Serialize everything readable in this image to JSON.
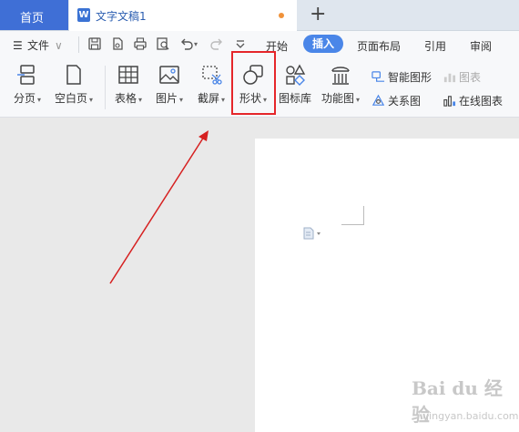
{
  "tabs": {
    "home_label": "首页",
    "doc_title": "文字文稿1",
    "doc_icon_letter": "W",
    "add_symbol": "+"
  },
  "menu": {
    "file_label": "文件",
    "items": [
      "开始",
      "插入",
      "页面布局",
      "引用",
      "审阅"
    ],
    "active": "插入"
  },
  "ribbon": {
    "page_break": "分页",
    "blank_page": "空白页",
    "table": "表格",
    "picture": "图片",
    "screenshot": "截屏",
    "shape": "形状",
    "icon_library": "图标库",
    "function_chart": "功能图",
    "smart_graphic": "智能图形",
    "chart": "图表",
    "relation_chart": "关系图",
    "online_chart": "在线图表",
    "dropdown": "▾"
  },
  "watermark": {
    "brand": "Bai du 经验",
    "url": "jingyan.baidu.com"
  },
  "colors": {
    "accent": "#4a86e8",
    "highlight": "#e5262a",
    "arrow": "#d62020"
  }
}
